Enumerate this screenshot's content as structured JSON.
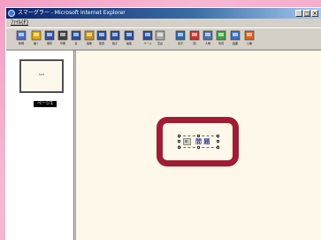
{
  "window": {
    "title": "スマーグラー - Microsoft Internet Explorer",
    "controls": [
      "_",
      "□",
      "×"
    ]
  },
  "menu": {
    "first_item": "ﾌｧｲﾙ(F)"
  },
  "toolbar": {
    "buttons": [
      {
        "icon": "new-document-icon",
        "label": "新規",
        "color": "#4a6ec8"
      },
      {
        "icon": "open-folder-icon",
        "label": "開く",
        "color": "#e0a800"
      },
      {
        "icon": "save-icon",
        "label": "保存",
        "color": "#3050a0"
      },
      {
        "icon": "print-icon",
        "label": "印刷",
        "color": "#404040"
      },
      {
        "icon": "table-icon",
        "label": "表",
        "color": "#2c4f9a"
      },
      {
        "icon": "image-icon",
        "label": "画像",
        "color": "#c89018"
      },
      {
        "icon": "layout-icon",
        "label": "配置",
        "color": "#2c4f9a"
      },
      {
        "icon": "grid-icon",
        "label": "格子",
        "color": "#2c4f9a"
      },
      {
        "icon": "edit-icon",
        "label": "編集",
        "color": "#2c4f9a"
      },
      {
        "icon": "page-icon",
        "label": "ページ",
        "color": "#2c4f9a"
      },
      {
        "icon": "blank-icon",
        "label": "空白",
        "color": "#aaaaaa"
      },
      {
        "icon": "view-icon",
        "label": "表示",
        "color": "#2c6ab0"
      },
      {
        "icon": "chart-icon",
        "label": "図",
        "color": "#d03030"
      },
      {
        "icon": "people-icon",
        "label": "人物",
        "color": "#5070b0"
      },
      {
        "icon": "photo-icon",
        "label": "写真",
        "color": "#40a040"
      },
      {
        "icon": "screen-icon",
        "label": "画面",
        "color": "#3a70c0"
      },
      {
        "icon": "globe-icon",
        "label": "公開",
        "color": "#e06020"
      }
    ]
  },
  "left_pane": {
    "thumbnail_text": "text",
    "page_label": "ページ1"
  },
  "canvas": {
    "object_text": "間 題",
    "highlight_color": "#a01c34"
  }
}
